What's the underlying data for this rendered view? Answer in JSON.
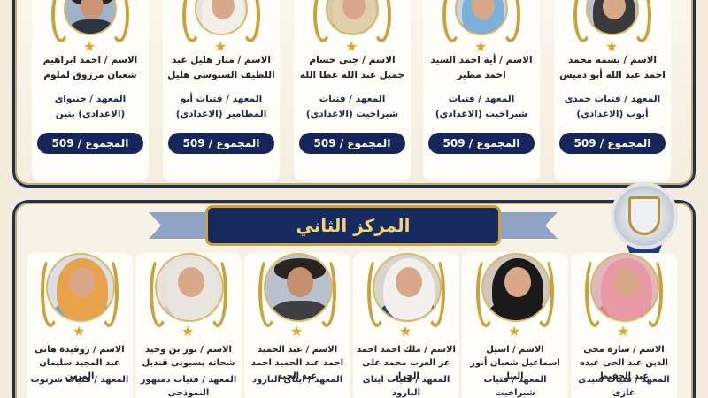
{
  "first_place": {
    "cards": [
      {
        "name": "الاسم / بسمه محمد احمد عبد الله أبو دميس",
        "institute": "المعهد / فتيات حمدى أيوب (الاعدادى)",
        "total": "المجموع / 509"
      },
      {
        "name": "الاسم / أية احمد السيد احمد مطير",
        "institute": "المعهد / فتيات شبراخيت (الاعدادى)",
        "total": "المجموع / 509"
      },
      {
        "name": "الاسم / جنى حسام جميل عبد الله عطا الله",
        "institute": "المعهد / فتيات شبراخيت (الاعدادى)",
        "total": "المجموع / 509"
      },
      {
        "name": "الاسم / منار هليل عبد اللطيف السنوسى هليل",
        "institute": "المعهد / فتيات أبو المطامير (الاعدادى)",
        "total": "المجموع / 509"
      },
      {
        "name": "الاسم / احمد ابراهيم شعبان مرزوق لملوم",
        "institute": "المعهد / جنبواى (الاعدادى) بنين",
        "total": "المجموع / 509"
      }
    ]
  },
  "second_place": {
    "title": "المركز الثاني",
    "cards": [
      {
        "name": "الاسم / سارة محى الدين عبد الحى عبده عبد الحفيظ",
        "institute": "المعهد / فتيات سيدى غازى"
      },
      {
        "name": "الاسم / اسيل اسماعيل شعبان أنور البنا",
        "institute": "المعهد / فتيات شبراخيت"
      },
      {
        "name": "الاسم / ملك احمد احمد عز العرب محمد على الجزار",
        "institute": "المعهد / فتيات ايتاى البارود"
      },
      {
        "name": "الاسم / عبد الحميد احمد عبد الحميد احمد عبد الجيد",
        "institute": "المعهد / ايتاى البارود"
      },
      {
        "name": "الاسم / نور بن وحيد شحاته بسيونى قنديل",
        "institute": "المعهد / فتيات دمنهور النموذجى"
      },
      {
        "name": "الاسم / روقيدة هانى عبد المجيد سليمان المزين",
        "institute": "المعهد / فتيات شرنوب"
      }
    ]
  },
  "colors": {
    "navy": "#172a5e",
    "gold": "#c9a23d",
    "cream": "#f3ecdd"
  }
}
